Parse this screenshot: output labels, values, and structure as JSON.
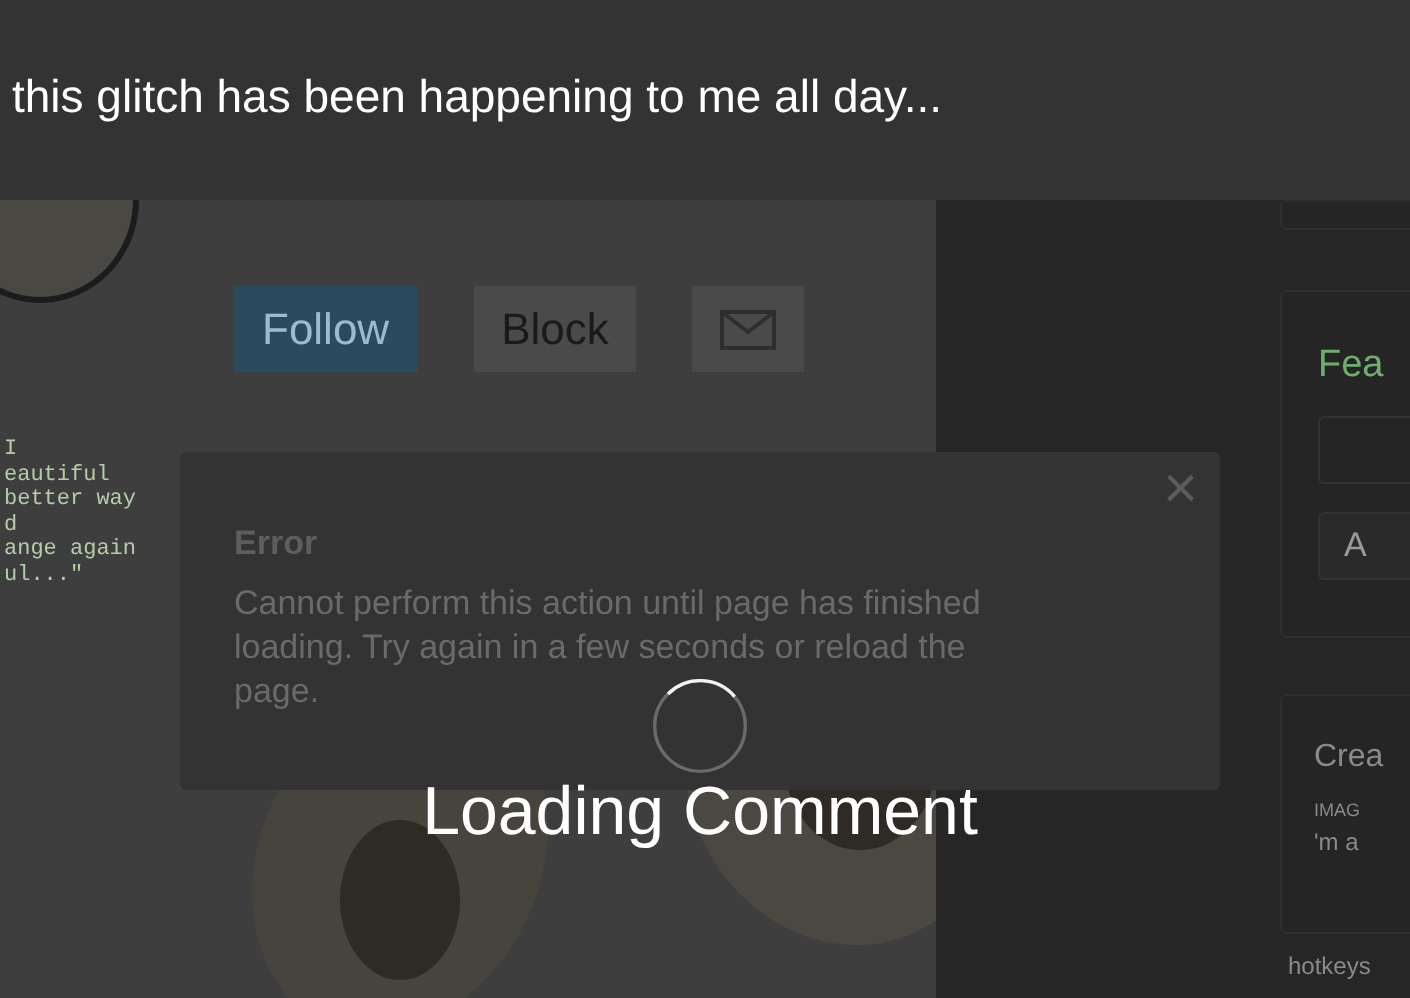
{
  "caption": "this glitch has been happening to me all day...",
  "profile": {
    "quote_lines": [
      "I",
      "eautiful",
      "better way",
      "d",
      "ange again",
      "ul...\""
    ],
    "buttons": [
      {
        "label": "Follow",
        "kind": "primary"
      },
      {
        "label": "Block",
        "kind": "plain"
      }
    ]
  },
  "sidebar": {
    "feature_card": {
      "title": "Fea",
      "button": "A"
    },
    "create_card": {
      "title": "Crea",
      "label": "IMAG",
      "text": "'m a"
    },
    "footer": "hotkeys"
  },
  "dialog": {
    "title": "Error",
    "message": "Cannot perform this action until page has finished loading. Try again in a few seconds or reload the page.",
    "close": "×"
  },
  "loading": {
    "label": "Loading Comment"
  }
}
